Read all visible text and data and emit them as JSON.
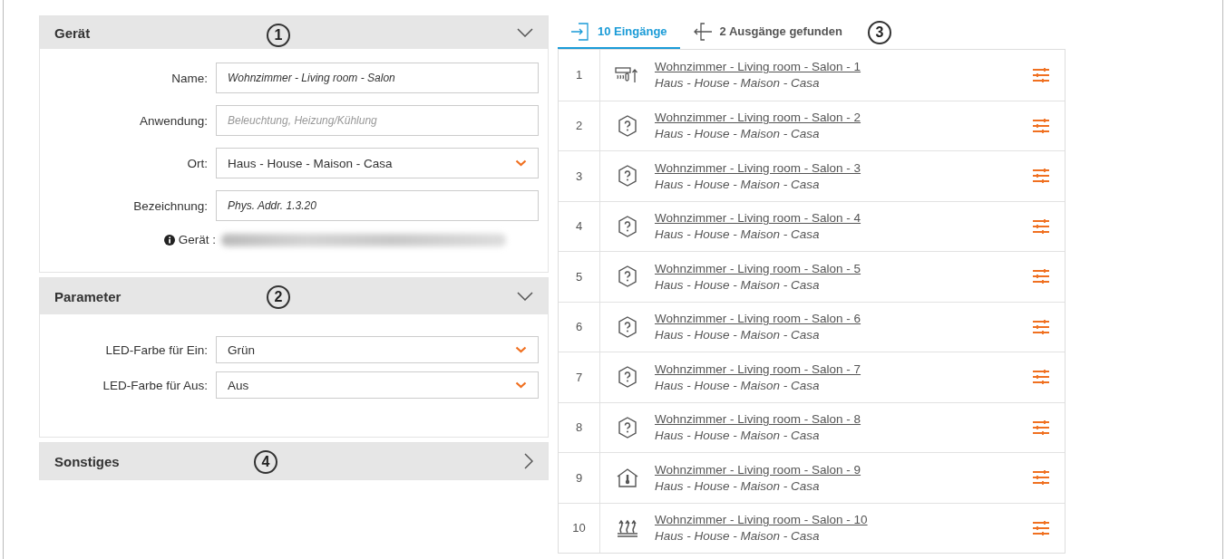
{
  "sections": [
    {
      "title": "Gerät",
      "expanded": true,
      "callout": "1",
      "fields": [
        {
          "kind": "text",
          "label": "Name:",
          "value": "Wohnzimmer - Living room - Salon"
        },
        {
          "kind": "text",
          "label": "Anwendung:",
          "placeholder": "Beleuchtung, Heizung/Kühlung"
        },
        {
          "kind": "select",
          "label": "Ort:",
          "value": "Haus - House - Maison - Casa"
        },
        {
          "kind": "text",
          "label": "Bezeichnung:",
          "value": "Phys. Addr. 1.3.20"
        },
        {
          "kind": "info",
          "label": "Gerät :"
        }
      ]
    },
    {
      "title": "Parameter",
      "expanded": true,
      "callout": "2",
      "fields": [
        {
          "kind": "select",
          "label": "LED-Farbe für Ein:",
          "value": "Grün"
        },
        {
          "kind": "select",
          "label": "LED-Farbe für Aus:",
          "value": "Aus"
        }
      ]
    },
    {
      "title": "Sonstiges",
      "expanded": false,
      "callout": "4"
    }
  ],
  "tabs": [
    {
      "kind": "inputs",
      "label": "10 Eingänge",
      "selected": true
    },
    {
      "kind": "outputs",
      "label": "2 Ausgänge gefunden",
      "selected": false
    }
  ],
  "tabs_callout": "3",
  "rows": [
    {
      "number": "1",
      "kind": "heating-cooling",
      "name": "Wohnzimmer - Living room - Salon - 1",
      "location": "Haus - House - Maison - Casa"
    },
    {
      "number": "2",
      "kind": "unknown",
      "name": "Wohnzimmer - Living room - Salon - 2",
      "location": "Haus - House - Maison - Casa"
    },
    {
      "number": "3",
      "kind": "unknown",
      "name": "Wohnzimmer - Living room - Salon - 3",
      "location": "Haus - House - Maison - Casa"
    },
    {
      "number": "4",
      "kind": "unknown",
      "name": "Wohnzimmer - Living room - Salon - 4",
      "location": "Haus - House - Maison - Casa"
    },
    {
      "number": "5",
      "kind": "unknown",
      "name": "Wohnzimmer - Living room - Salon - 5",
      "location": "Haus - House - Maison - Casa"
    },
    {
      "number": "6",
      "kind": "unknown",
      "name": "Wohnzimmer - Living room - Salon - 6",
      "location": "Haus - House - Maison - Casa"
    },
    {
      "number": "7",
      "kind": "unknown",
      "name": "Wohnzimmer - Living room - Salon - 7",
      "location": "Haus - House - Maison - Casa"
    },
    {
      "number": "8",
      "kind": "unknown",
      "name": "Wohnzimmer - Living room - Salon - 8",
      "location": "Haus - House - Maison - Casa"
    },
    {
      "number": "9",
      "kind": "house-temperature",
      "name": "Wohnzimmer - Living room - Salon - 9",
      "location": "Haus - House - Maison - Casa"
    },
    {
      "number": "10",
      "kind": "floor-heating",
      "name": "Wohnzimmer - Living room - Salon - 10",
      "location": "Haus - House - Maison - Casa"
    }
  ]
}
